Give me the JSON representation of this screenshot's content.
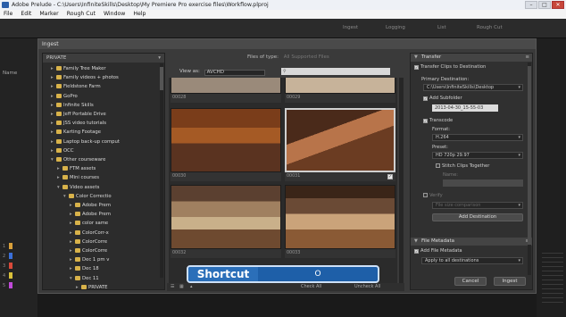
{
  "window": {
    "title": "Adobe Prelude - C:\\Users\\InfiniteSkills\\Desktop\\My Premiere Pro exercise files\\Workflow.plproj",
    "buttons": {
      "minimize": "–",
      "maximize": "□",
      "close": "✕"
    }
  },
  "menu": [
    "File",
    "Edit",
    "Marker",
    "Rough Cut",
    "Window",
    "Help"
  ],
  "toolbar": [
    "Ingest",
    "Logging",
    "List",
    "Rough Cut"
  ],
  "left_panel": {
    "tab": "Name",
    "track_numbers": [
      "1",
      "2",
      "3",
      "4",
      "5"
    ],
    "track_colors": [
      "#d9a03a",
      "#3a6fd9",
      "#d94a3a",
      "#d9c03a",
      "#c04ad9"
    ]
  },
  "dialog": {
    "title": "Ingest",
    "tree": {
      "header": "PRIVATE",
      "items": [
        {
          "label": "Family Tree Maker",
          "indent": 1
        },
        {
          "label": "Family videos + photos",
          "indent": 1
        },
        {
          "label": "Fieldstone Farm",
          "indent": 1
        },
        {
          "label": "GoPro",
          "indent": 1
        },
        {
          "label": "Infinite Skills",
          "indent": 1
        },
        {
          "label": "Jeff Portable Drive",
          "indent": 1
        },
        {
          "label": "JSS video tutorials",
          "indent": 1
        },
        {
          "label": "Karting Footage",
          "indent": 1
        },
        {
          "label": "Laptop back-up comput",
          "indent": 1
        },
        {
          "label": "OCC",
          "indent": 1
        },
        {
          "label": "Other courseware",
          "indent": 1,
          "open": true
        },
        {
          "label": "FTM assets",
          "indent": 2
        },
        {
          "label": "Mini courses",
          "indent": 2
        },
        {
          "label": "Video assets",
          "indent": 2,
          "open": true
        },
        {
          "label": "Color Correctio",
          "indent": 3,
          "open": true
        },
        {
          "label": "Adobe Prem",
          "indent": 4
        },
        {
          "label": "Adobe Prem",
          "indent": 4
        },
        {
          "label": "color same",
          "indent": 4
        },
        {
          "label": "ColorCorr-x",
          "indent": 4
        },
        {
          "label": "ColorCorre",
          "indent": 4
        },
        {
          "label": "ColorCorre",
          "indent": 4
        },
        {
          "label": "Dec 1 pm v",
          "indent": 4
        },
        {
          "label": "Dec 18",
          "indent": 4
        },
        {
          "label": "Dec 11",
          "indent": 4,
          "open": true
        },
        {
          "label": "PRIVATE",
          "indent": 5
        }
      ]
    },
    "files_of_type_label": "Files of type:",
    "files_of_type_value": "All Supported Files",
    "view_as_label": "View as:",
    "view_as_value": "AVCHD",
    "clips": [
      {
        "name": "00028",
        "checked": false
      },
      {
        "name": "00029",
        "checked": false
      },
      {
        "name": "00030",
        "checked": false
      },
      {
        "name": "00031",
        "checked": true
      },
      {
        "name": "00032",
        "checked": false
      },
      {
        "name": "00033",
        "checked": false
      }
    ],
    "grid_footer": {
      "check_all": "Check All",
      "uncheck_all": "Uncheck All"
    },
    "transfer": {
      "header": "Transfer",
      "transfer_clips": "Transfer Clips to Destination",
      "primary_destination_label": "Primary Destination:",
      "primary_destination_value": "C:\\Users\\InfiniteSkills\\Desktop",
      "add_subfolder": "Add Subfolder",
      "subfolder_value": "2013-04-30_15-55-03",
      "transcode": "Transcode",
      "format_label": "Format:",
      "format_value": "H.264",
      "preset_label": "Preset:",
      "preset_value": "HD 720p 29.97",
      "stitch": "Stitch Clips Together",
      "name_label": "Name:",
      "verify": "Verify",
      "verify_value": "File size comparison",
      "add_destination": "Add Destination"
    },
    "file_metadata": {
      "header": "File Metadata",
      "add_file_metadata": "Add File Metadata",
      "apply_value": "Apply to all destinations"
    },
    "buttons": {
      "cancel": "Cancel",
      "ingest": "Ingest"
    }
  },
  "overlay": {
    "label": "Shortcut",
    "key": "O"
  }
}
